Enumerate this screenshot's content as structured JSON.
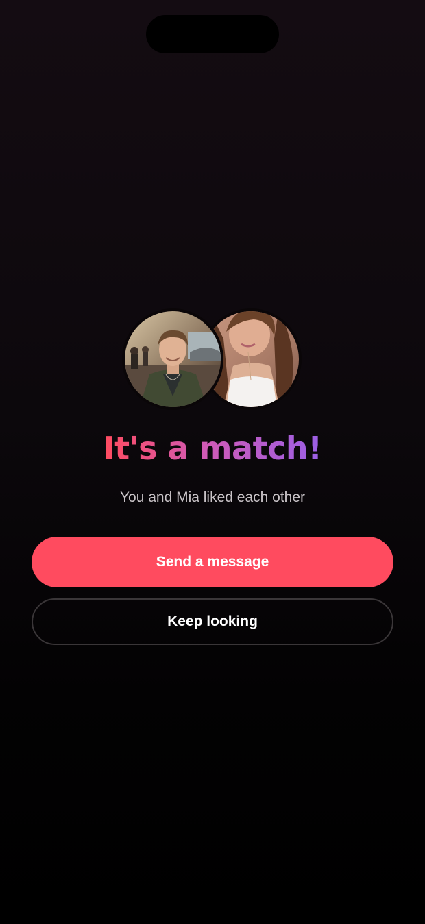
{
  "match_screen": {
    "headline": "It's a match!",
    "subtitle": "You and Mia liked each other",
    "primary_button_label": "Send a message",
    "secondary_button_label": "Keep looking",
    "headline_gradient": [
      "#ff4b5f",
      "#d25ab4",
      "#9b5fe6"
    ],
    "primary_button_color": "#ff4b5f"
  }
}
